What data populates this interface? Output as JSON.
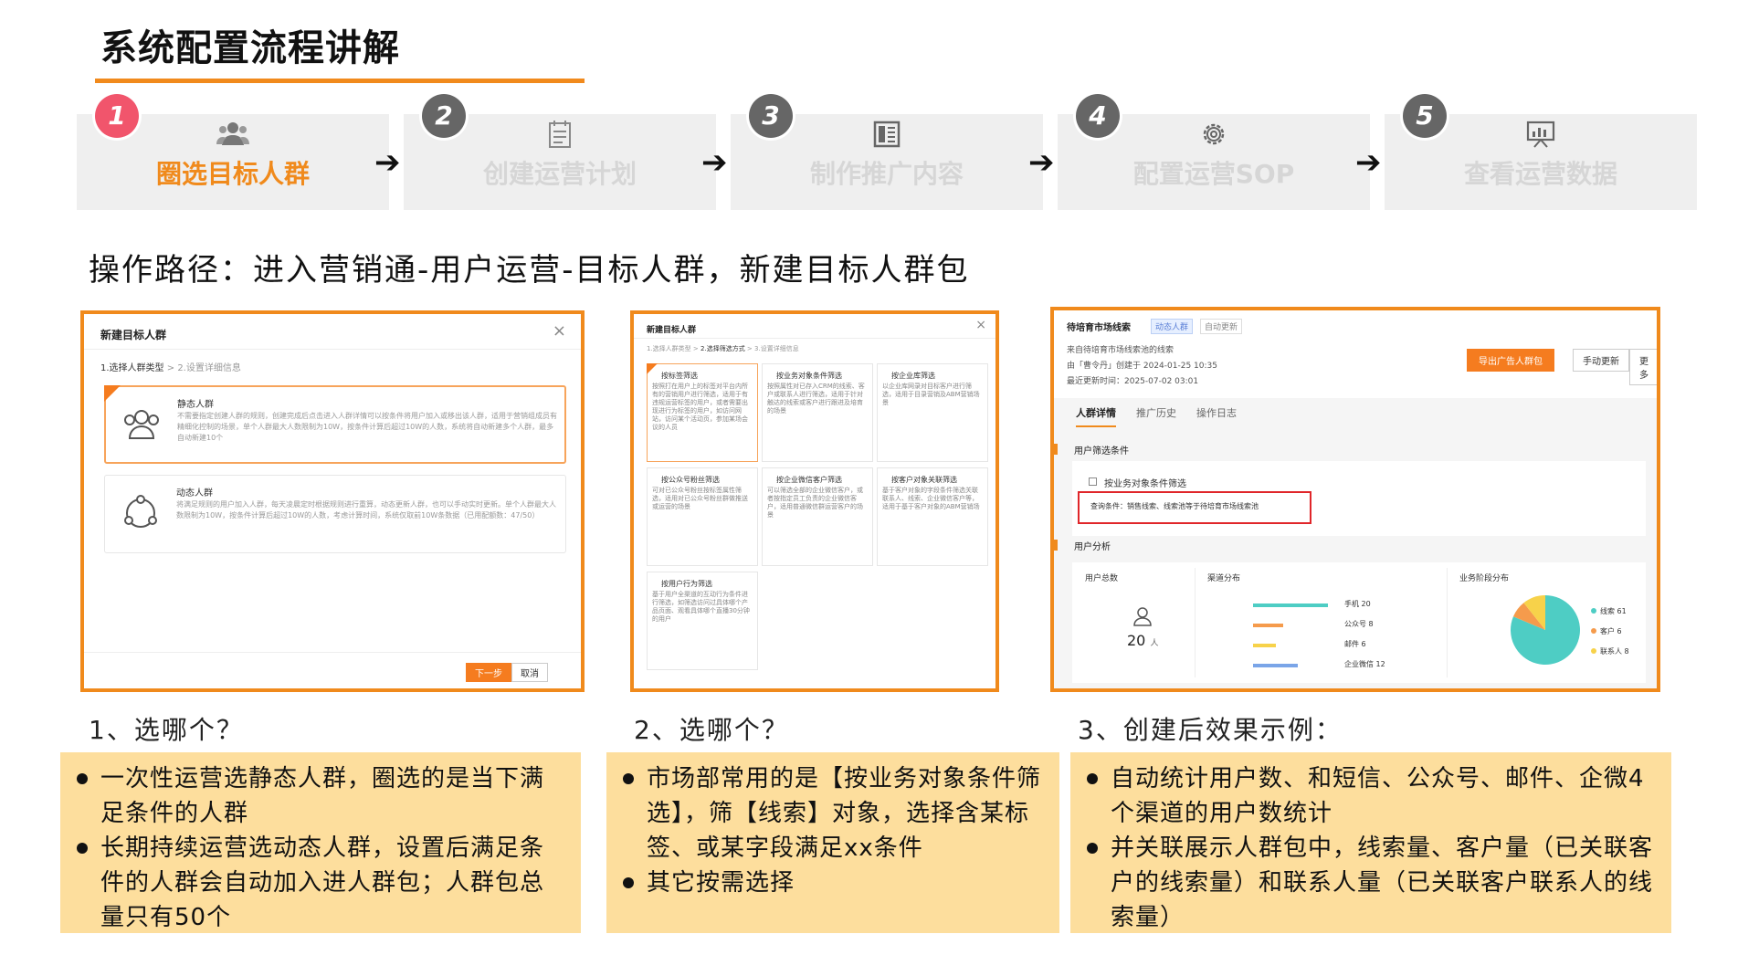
{
  "page": {
    "title": "系统配置流程讲解",
    "path_text": "操作路径：进入营销通-用户运营-目标人群，新建目标人群包"
  },
  "steps": [
    {
      "num": "1",
      "label": "圈选目标人群",
      "icon": "users-icon",
      "active": true
    },
    {
      "num": "2",
      "label": "创建运营计划",
      "icon": "calendar-list-icon",
      "active": false
    },
    {
      "num": "3",
      "label": "制作推广内容",
      "icon": "layout-icon",
      "active": false
    },
    {
      "num": "4",
      "label": "配置运营SOP",
      "icon": "gear-icon",
      "active": false
    },
    {
      "num": "5",
      "label": "查看运营数据",
      "icon": "presentation-chart-icon",
      "active": false
    }
  ],
  "arrow_glyph": "➔",
  "shot1": {
    "title": "新建目标人群",
    "close": "×",
    "breadcrumb_step1": "1.选择人群类型",
    "breadcrumb_sep": ">",
    "breadcrumb_step2": "2.设置详细信息",
    "static_title": "静态人群",
    "static_desc": "不需要指定创建人群的规则，创建完成后点击进入人群详情可以按条件将用户加入或移出该人群，适用于营销组成员有精细化控制的场景，单个人群最大人数限制为10W，按条件计算后超过10W的人数，系统将自动新建多个人群，最多自动新建10个",
    "dynamic_title": "动态人群",
    "dynamic_desc": "将满足规则的用户加入人群，每天凌晨定时根据规则进行重算，动态更新人群，也可以手动实时更新。单个人群最大人数限制为10W，按条件计算后超过10W的人数，考虑计算时间，系统仅取前10W条数据（已用配额数：47/50）",
    "next_btn": "下一步",
    "cancel_btn": "取消"
  },
  "shot2": {
    "title": "新建目标人群",
    "close": "×",
    "breadcrumb": [
      "1.选择人群类型",
      "2.选择筛选方式",
      "3.设置详细信息"
    ],
    "cards": [
      {
        "t": "按标签筛选",
        "d": "按照打在用户上的标签对平台内所有的营销用户进行筛选，适用于有违规运营标签的用户，或者需要出现进行为标签的用户，如访问网站，访问某个活动页，参加某场会议的人员"
      },
      {
        "t": "按业务对象条件筛选",
        "d": "按照属性对已存入CRM的线索、客户或联系人进行筛选，适用于针对触达的线索或客户进行跟进及培育的场景"
      },
      {
        "t": "按企业库筛选",
        "d": "以企业库网录对目标客户进行筛选，适用于目录营销及ABM营销场景"
      },
      {
        "t": "按公众号粉丝筛选",
        "d": "可对已公众号粉丝按标签属性筛选，适用对已公众号粉丝群做推送或运营的场景"
      },
      {
        "t": "按企业微信客户筛选",
        "d": "可以筛选全部的企业微信客户，或者按指定员工负责的企业微信客户，适用普通微信群运营客户的场景"
      },
      {
        "t": "按客户对象关联筛选",
        "d": "基于客户对象的字段条件筛选关联联系人、线索、企业微信客户等，适用于基于客户对象的ABM营销场"
      },
      {
        "t": "按用户行为筛选",
        "d": "基于用户全渠道的互动行为条件进行筛选，如筛选访问过具体哪个产品页面、观看具体哪个直播30分钟的用户"
      }
    ]
  },
  "shot3": {
    "name": "待培育市场线索",
    "tag1": "动态人群",
    "tag2": "自动更新",
    "source": "来自待培育市场线索池的线索",
    "creator": "由「曹令丹」创建于 2024-01-25 10:35",
    "updated": "最近更新时间：2025-07-02 03:01",
    "btn_export": "导出广告人群包",
    "btn_refresh": "手动更新",
    "btn_more": "更多",
    "tabs": [
      "人群详情",
      "推广历史",
      "操作日志"
    ],
    "filter_section": "用户筛选条件",
    "filter_type": "按业务对象条件筛选",
    "filter_query": "查询条件：销售线索、线索池等于待培育市场线索池",
    "analysis_section": "用户分析",
    "total_label": "用户总数",
    "total_value": "20",
    "total_unit": "人",
    "channel_label": "渠道分布",
    "stage_label": "业务阶段分布",
    "channels": [
      {
        "name": "手机",
        "value": "20",
        "color": "#4ecdc4"
      },
      {
        "name": "公众号",
        "value": "8",
        "color": "#f59b4c"
      },
      {
        "name": "邮件",
        "value": "6",
        "color": "#f7d24a"
      },
      {
        "name": "企业微信",
        "value": "12",
        "color": "#7aa5e8"
      }
    ],
    "stages": [
      {
        "name": "线索",
        "value": "61",
        "color": "#4ecdc4"
      },
      {
        "name": "客户",
        "value": "6",
        "color": "#f59b4c"
      },
      {
        "name": "联系人",
        "value": "8",
        "color": "#f7d24a"
      }
    ]
  },
  "notes": [
    {
      "question": "1、选哪个？",
      "items": [
        "一次性运营选静态人群，圈选的是当下满足条件的人群",
        "长期持续运营选动态人群，设置后满足条件的人群会自动加入进人群包；人群包总量只有50个"
      ]
    },
    {
      "question": "2、选哪个？",
      "items": [
        "市场部常用的是【按业务对象条件筛选】，筛【线索】对象，选择含某标签、或某字段满足xx条件",
        "其它按需选择"
      ]
    },
    {
      "question": "3、创建后效果示例：",
      "items": [
        "自动统计用户数、和短信、公众号、邮件、企微4个渠道的用户数统计",
        "并关联展示人群包中，线索量、客户量（已关联客户的线索量）和联系人量（已关联客户联系人的线索量）"
      ]
    }
  ]
}
